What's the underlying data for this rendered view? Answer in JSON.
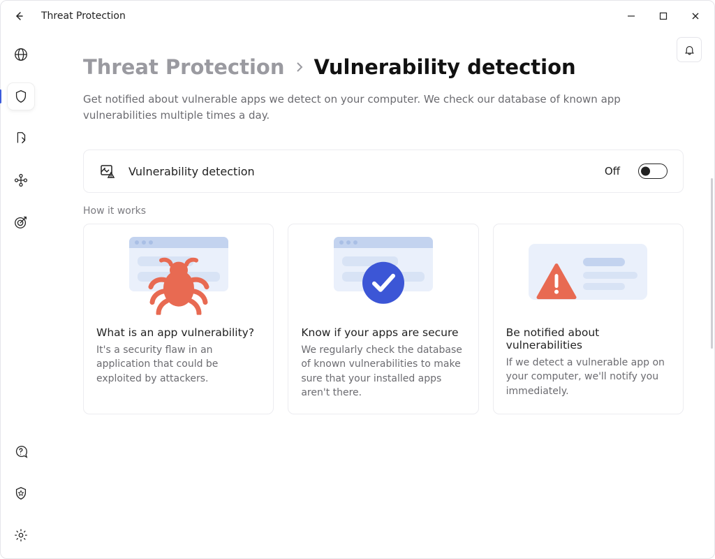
{
  "window": {
    "title": "Threat Protection"
  },
  "breadcrumb": {
    "parent": "Threat Protection",
    "current": "Vulnerability detection"
  },
  "subtitle": "Get notified about vulnerable apps we detect on your computer. We check our database of known app vulnerabilities multiple times a day.",
  "toggle": {
    "label": "Vulnerability detection",
    "state": "Off",
    "on": false
  },
  "section_label": "How it works",
  "cards": [
    {
      "title": "What is an app vulnerability?",
      "desc": "It's a security flaw in an application that could be exploited by attackers."
    },
    {
      "title": "Know if your apps are secure",
      "desc": "We regularly check the database of known vulnerabilities to make sure that your installed apps aren't there."
    },
    {
      "title": "Be notified about vulnerabilities",
      "desc": "If we detect a vulnerable app on your computer, we'll notify you immediately."
    }
  ]
}
